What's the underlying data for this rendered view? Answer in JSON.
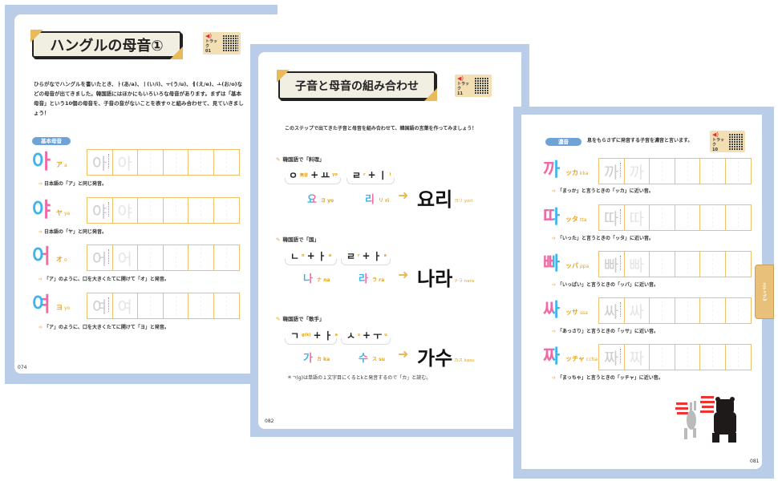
{
  "page_left": {
    "title": "ハングルの母音①",
    "track": {
      "label": "トラック",
      "number": "01"
    },
    "intro": "ひらがなでハングルを書いたとき、ㅏ(あ/a)、ㅣ(い/i)、ㅜ(う/u)、ㅔ(え/e)、ㅗ(お/o)などの母音が出てきました。韓国語にはほかにもいろいろな母音があります。まずは「基本母音」という10個の母音を、子音の音がないことを表すㅇと組み合わせて、見ていきましょう！",
    "section_label": "基本母音",
    "rows": [
      {
        "char": "아",
        "kana": "ア",
        "roman": "a",
        "note": "日本語の「ア」と同じ発音。"
      },
      {
        "char": "야",
        "kana": "ヤ",
        "roman": "ya",
        "note": "日本語の「ヤ」と同じ発音。"
      },
      {
        "char": "어",
        "kana": "オ",
        "roman": "o",
        "note": "「ア」のように、口を大きくたてに開けて「オ」と発音。"
      },
      {
        "char": "여",
        "kana": "ヨ",
        "roman": "yo",
        "note": "「ア」のように、口を大きくたてに開けて「ヨ」と発音。"
      }
    ],
    "page_number": "074"
  },
  "page_middle": {
    "title": "子音と母音の組み合わせ",
    "track": {
      "label": "トラック",
      "number": "11"
    },
    "intro": "このステップで出てきた子音と母音を組み合わせて、韓国語の言葉を作ってみましょう！",
    "sections": [
      {
        "heading": "韓国語で「料理」",
        "parts": [
          {
            "c": "ㅇ",
            "c_r": "無音",
            "v": "ㅛ",
            "v_r": "yo",
            "syll": "요",
            "syll_kana": "ヨ",
            "syll_roman": "yo"
          },
          {
            "c": "ㄹ",
            "c_r": "r",
            "v": "ㅣ",
            "v_r": "i",
            "syll": "리",
            "syll_kana": "リ",
            "syll_roman": "ri"
          }
        ],
        "word": "요리",
        "word_kana": "ヨリ",
        "word_roman": "yori"
      },
      {
        "heading": "韓国語で「国」",
        "parts": [
          {
            "c": "ㄴ",
            "c_r": "n",
            "v": "ㅏ",
            "v_r": "a",
            "syll": "나",
            "syll_kana": "ナ",
            "syll_roman": "na"
          },
          {
            "c": "ㄹ",
            "c_r": "r",
            "v": "ㅏ",
            "v_r": "a",
            "syll": "라",
            "syll_kana": "ラ",
            "syll_roman": "ra"
          }
        ],
        "word": "나라",
        "word_kana": "ナラ",
        "word_roman": "nara"
      },
      {
        "heading": "韓国語で「歌手」",
        "parts": [
          {
            "c": "ㄱ",
            "c_r": "g(k)",
            "v": "ㅏ",
            "v_r": "a",
            "syll": "가",
            "syll_kana": "カ",
            "syll_roman": "ka"
          },
          {
            "c": "ㅅ",
            "c_r": "s",
            "v": "ㅜ",
            "v_r": "u",
            "syll": "수",
            "syll_kana": "ス",
            "syll_roman": "su"
          }
        ],
        "word": "가수",
        "word_kana": "カス",
        "word_roman": "kasu"
      }
    ],
    "footnote": "＊ㄱ(g)は単語の１文字目にくるとkと発音するので「カ」と読む。",
    "page_number": "082"
  },
  "page_right": {
    "section_label": "濃音",
    "section_desc": "息をもらさずに発音する子音を濃音と言います。",
    "track": {
      "label": "トラック",
      "number": "10"
    },
    "tab_label": "ステップ3",
    "rows": [
      {
        "char": "까",
        "kana": "ッカ",
        "roman": "kka",
        "note": "「まっか」と言うときの「ッカ」に近い音。"
      },
      {
        "char": "따",
        "kana": "ッタ",
        "roman": "tta",
        "note": "「いった」と言うときの「ッタ」に近い音。"
      },
      {
        "char": "빠",
        "kana": "ッパ",
        "roman": "ppa",
        "note": "「いっぱい」と言うときの「ッパ」に近い音。"
      },
      {
        "char": "싸",
        "kana": "ッサ",
        "roman": "ssa",
        "note": "「あっさり」と言うときの「ッサ」に近い音。"
      },
      {
        "char": "짜",
        "kana": "ッチャ",
        "roman": "ccha",
        "note": "「まっちゃ」と言うときの「ッチャ」に近い音。"
      }
    ],
    "page_number": "081"
  },
  "colors": {
    "page_frame": "#b9cde8",
    "accent_gold": "#e9b95a",
    "consonant_blue": "#3db4ee",
    "vowel_pink": "#f06aa6",
    "grid": "#eec06a"
  }
}
